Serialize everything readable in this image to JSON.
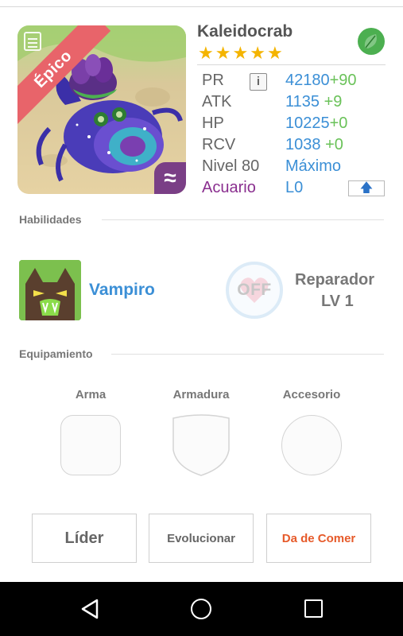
{
  "monster": {
    "name": "Kaleidocrab",
    "rarity": "Épico",
    "stars": 5,
    "element_icon": "leaf-icon",
    "attribute_icon": "water-wave-icon",
    "attribute_symbol": "≈",
    "colors": {
      "rarity_ribbon": "#e8646a",
      "stat_value": "#3b8fd6",
      "stat_bonus": "#6ac259",
      "attribute": "#7a3f86"
    }
  },
  "stats": {
    "pr": {
      "label": "PR",
      "value": "42180",
      "bonus": "+90"
    },
    "atk": {
      "label": "ATK",
      "value": "1135",
      "bonus": "+9"
    },
    "hp": {
      "label": "HP",
      "value": "10225",
      "bonus": "+0"
    },
    "rcv": {
      "label": "RCV",
      "value": "1038",
      "bonus": "+0"
    },
    "level": {
      "label": "Nivel 80",
      "value": "Máximo"
    },
    "sign": {
      "label": "Acuario",
      "value": "L0"
    }
  },
  "skills": {
    "section_title": "Habilidades",
    "active": {
      "name": "Vampiro"
    },
    "leader": {
      "state": "OFF",
      "name": "Reparador",
      "level": "LV 1"
    }
  },
  "equipment": {
    "section_title": "Equipamiento",
    "weapon_label": "Arma",
    "armor_label": "Armadura",
    "accessory_label": "Accesorio"
  },
  "actions": {
    "leader_label": "Líder",
    "evolve_label": "Evolucionar",
    "feed_label": "Da de Comer"
  }
}
